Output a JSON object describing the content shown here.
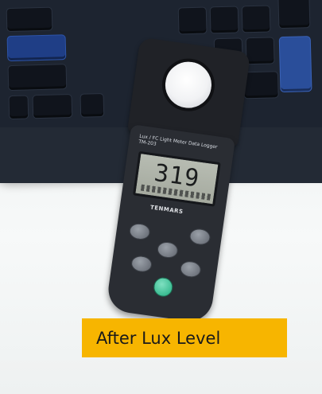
{
  "caption": {
    "text": "After Lux Level"
  },
  "meter": {
    "model_label": "Lux / FC Light Meter Data Logger  TM-203",
    "display_value": "319",
    "brand": "TENMARS"
  },
  "colors": {
    "caption_bg": "#f7b500",
    "keyboard": "#1d2430",
    "meter_body": "#2a2d33",
    "lcd": "#b0b5aa",
    "power_button": "#2fb58a"
  }
}
